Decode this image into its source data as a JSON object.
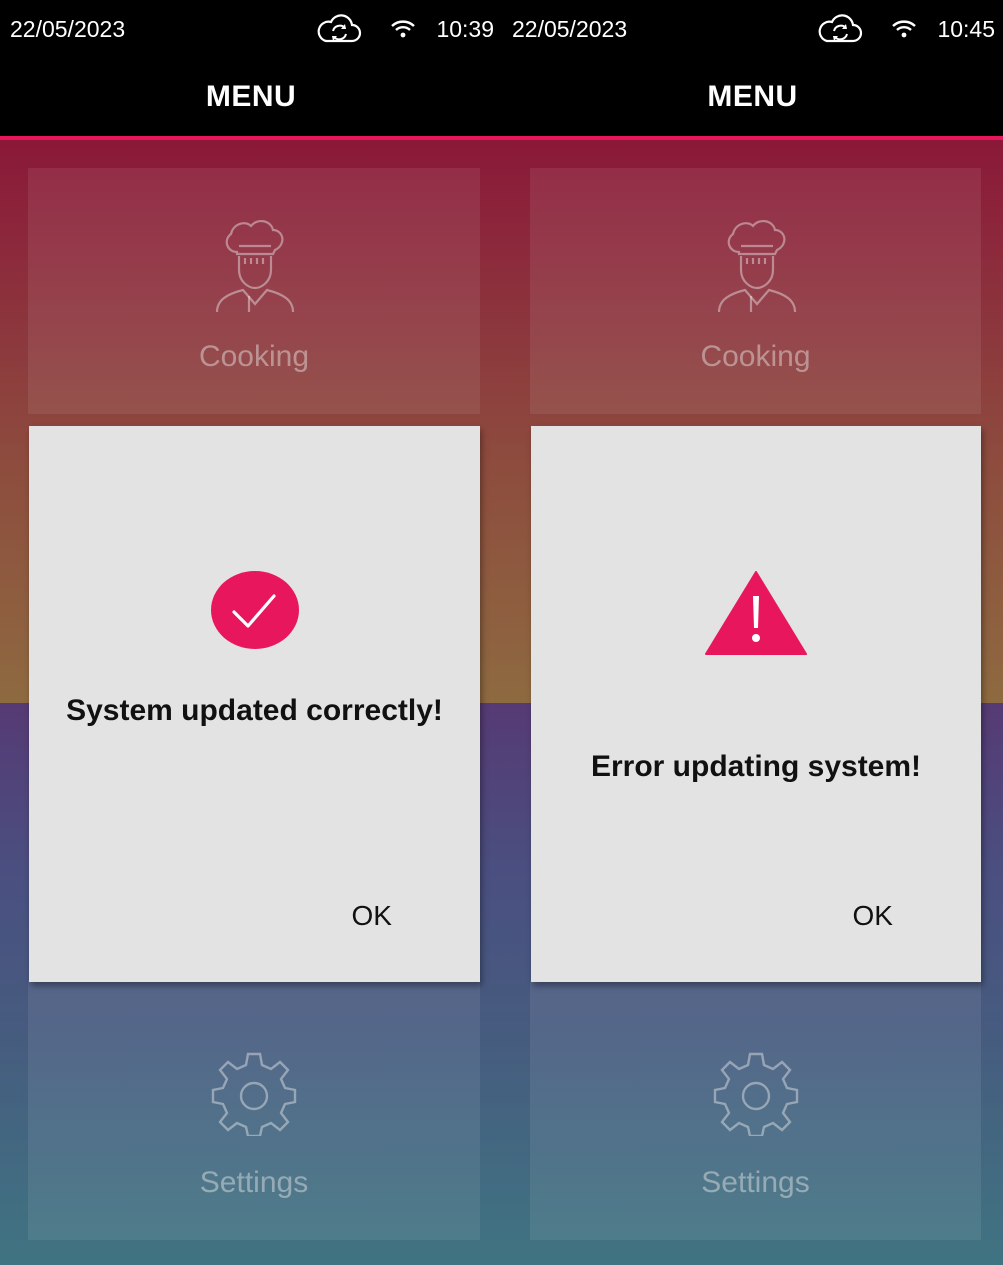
{
  "colors": {
    "accent": "#e8175d",
    "bar": "#000000",
    "dialog_bg": "#e3e3e3"
  },
  "screens": [
    {
      "status": {
        "date": "22/05/2023",
        "time": "10:39",
        "icons": [
          "cloud-sync-icon",
          "wifi-icon"
        ]
      },
      "header": {
        "title": "MENU"
      },
      "tiles": {
        "cooking": {
          "label": "Cooking",
          "icon": "chef-icon"
        },
        "settings": {
          "label": "Settings",
          "icon": "gear-icon"
        }
      },
      "dialog": {
        "icon": "check-circle-icon",
        "message": "System updated correctly!",
        "ok": "OK"
      }
    },
    {
      "status": {
        "date": "22/05/2023",
        "time": "10:45",
        "icons": [
          "cloud-sync-icon",
          "wifi-icon"
        ]
      },
      "header": {
        "title": "MENU"
      },
      "tiles": {
        "cooking": {
          "label": "Cooking",
          "icon": "chef-icon"
        },
        "settings": {
          "label": "Settings",
          "icon": "gear-icon"
        }
      },
      "dialog": {
        "icon": "warning-triangle-icon",
        "message": "Error updating system!",
        "ok": "OK"
      }
    }
  ]
}
